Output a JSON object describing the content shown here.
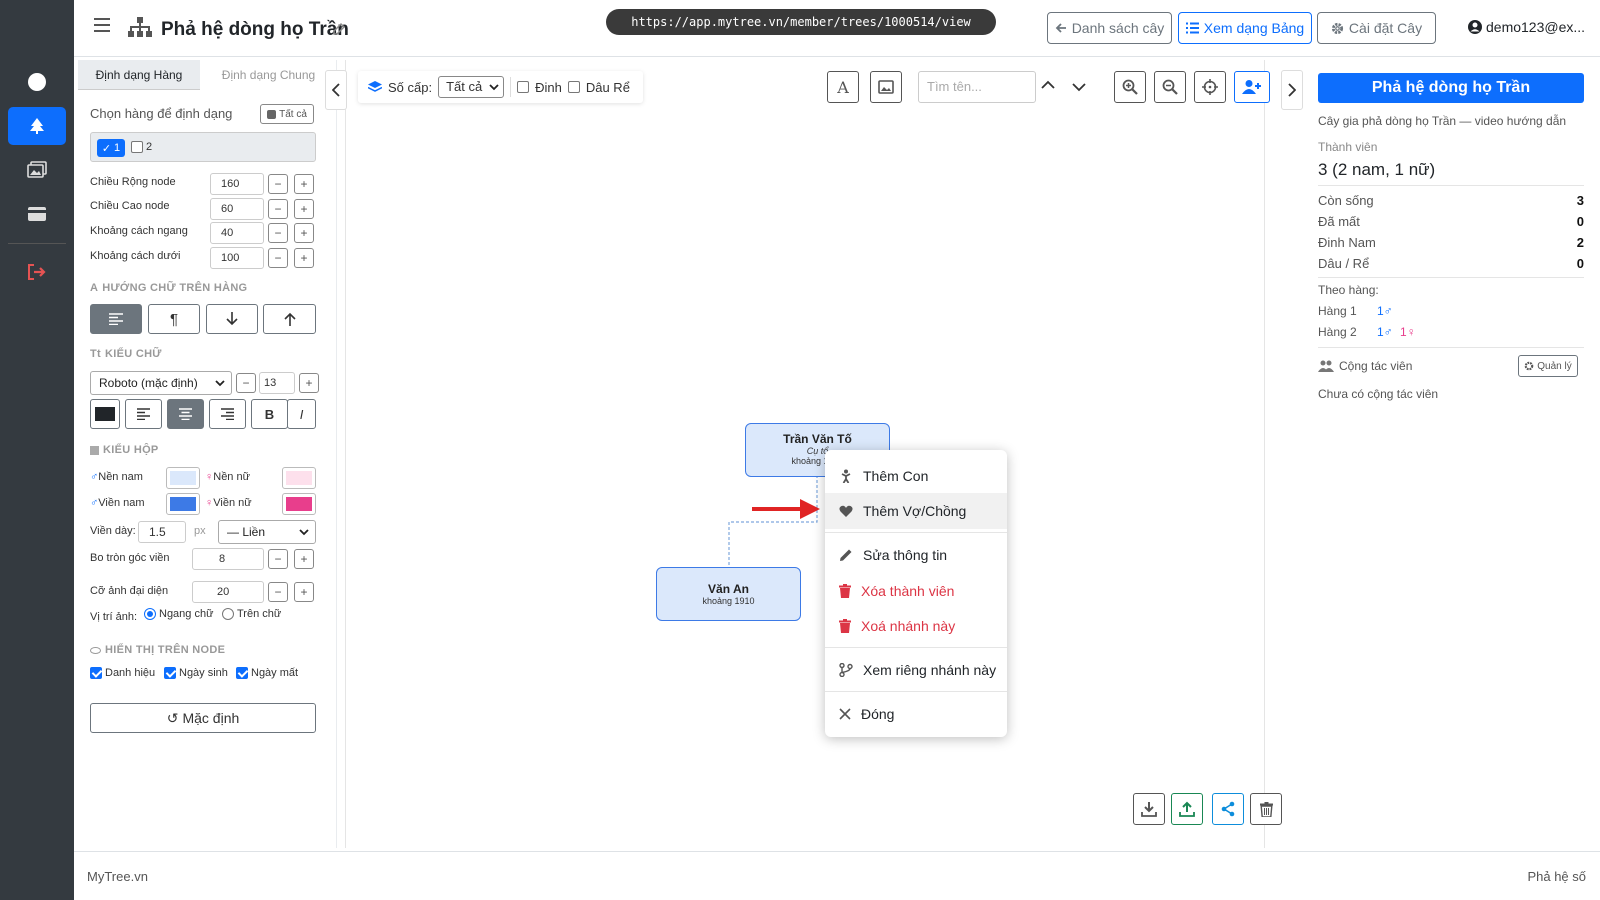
{
  "app": {
    "title": "Phả hệ dòng họ Trần",
    "url": "https://app.mytree.vn/member/trees/1000514/view"
  },
  "header": {
    "list_btn": "Danh sách cây",
    "table_btn": "Xem dạng Bảng",
    "settings_btn": "Cài đặt Cây",
    "user": "demo123@ex..."
  },
  "left_panel": {
    "tab_row": "Định dạng Hàng",
    "tab_general": "Định dạng Chung",
    "choose_rows": "Chọn hàng để định dạng",
    "all_btn": "Tất cả",
    "rows": [
      "1",
      "2"
    ],
    "fields": [
      {
        "label": "Chiều Rộng node",
        "value": "160"
      },
      {
        "label": "Chiều Cao node",
        "value": "60"
      },
      {
        "label": "Khoảng cách ngang",
        "value": "40"
      },
      {
        "label": "Khoảng cách dưới",
        "value": "100"
      }
    ],
    "text_dir_title": "HƯỚNG CHỮ TRÊN HÀNG",
    "font_title": "KIỂU CHỮ",
    "font_value": "Roboto (mặc định)",
    "font_size": "13",
    "bold": "B",
    "italic": "I",
    "box_title": "KIỂU HỘP",
    "male_bg": "Nền nam",
    "female_bg": "Nền nữ",
    "male_border": "Viền nam",
    "female_border": "Viền nữ",
    "colors": {
      "male_bg": "#dbe8fb",
      "female_bg": "#fde0ec",
      "male_border": "#3d7ae6",
      "female_border": "#e83e8c"
    },
    "border_width_label": "Viền dày:",
    "border_width": "1.5",
    "px": "px",
    "border_style": "— Liền",
    "radius_label": "Bo tròn góc viền",
    "radius": "8",
    "avatar_label": "Cỡ ảnh đại diện",
    "avatar": "20",
    "img_pos_label": "Vị trí ảnh:",
    "img_pos_horizontal": "Ngang chữ",
    "img_pos_above": "Trên chữ",
    "display_title": "HIỂN THỊ TRÊN NODE",
    "show_title": "Danh hiệu",
    "show_birth": "Ngày sinh",
    "show_death": "Ngày mất",
    "reset_btn": "Mặc định"
  },
  "canvas": {
    "levels_label": "Số cấp:",
    "levels_value": "Tất cả",
    "filter_male": "Đinh",
    "filter_inlaw": "Dâu Rể",
    "search_placeholder": "Tìm tên...",
    "node_root": {
      "name": "Trần Văn Tố",
      "title": "Cụ tổ",
      "year": "khoảng 1880"
    },
    "node_child": {
      "name": "Văn An",
      "year": "khoảng 1910"
    }
  },
  "context_menu": {
    "items": [
      "Thêm Con",
      "Thêm Vợ/Chồng",
      "Sửa thông tin",
      "Xóa thành viên",
      "Xoá nhánh này",
      "Xem riêng nhánh này",
      "Đóng"
    ]
  },
  "right_panel": {
    "title": "Phả hệ dòng họ Trần",
    "description": "Cây gia phả dòng họ Trần — video hướng dẫn",
    "members_label": "Thành viên",
    "members_value": "3 (2 nam, 1 nữ)",
    "stats": [
      {
        "label": "Còn sống",
        "value": "3"
      },
      {
        "label": "Đã mất",
        "value": "0"
      },
      {
        "label": "Đinh Nam",
        "value": "2"
      },
      {
        "label": "Dâu / Rể",
        "value": "0"
      }
    ],
    "by_row_label": "Theo hàng:",
    "row1_label": "Hàng 1",
    "row1_value": "1♂",
    "row2_label": "Hàng 2",
    "row2_male": "1♂",
    "row2_female": "1♀",
    "collab_label": "Cộng tác viên",
    "manage_btn": "Quản lý",
    "no_collab": "Chưa có cộng tác viên"
  },
  "footer": {
    "left": "MyTree.vn",
    "right": "Phả hệ số"
  }
}
